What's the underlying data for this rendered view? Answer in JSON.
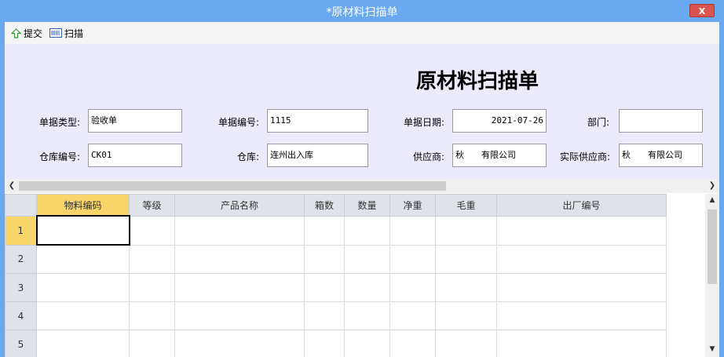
{
  "window": {
    "title": "*原材料扫描单",
    "close_label": "X"
  },
  "toolbar": {
    "submit_label": "提交",
    "scan_label": "扫描"
  },
  "form": {
    "heading": "原材料扫描单",
    "doc_type_label": "单据类型:",
    "doc_type_value": "验收单",
    "doc_no_label": "单据编号:",
    "doc_no_value": "1115",
    "doc_date_label": "单据日期:",
    "doc_date_value": "2021-07-26",
    "dept_label": "部门:",
    "dept_value": "",
    "wh_code_label": "仓库编号:",
    "wh_code_value": "CK01",
    "wh_label": "仓库:",
    "wh_value": "连州出入库",
    "supplier_label": "供应商:",
    "supplier_value": "秋　　有限公司",
    "actual_supplier_label": "实际供应商:",
    "actual_supplier_value": "秋　　有限公司"
  },
  "grid": {
    "columns": [
      "物料编码",
      "等级",
      "产品名称",
      "箱数",
      "数量",
      "净重",
      "毛重",
      "出厂编号"
    ],
    "rows": [
      "1",
      "2",
      "3",
      "4",
      "5"
    ]
  }
}
